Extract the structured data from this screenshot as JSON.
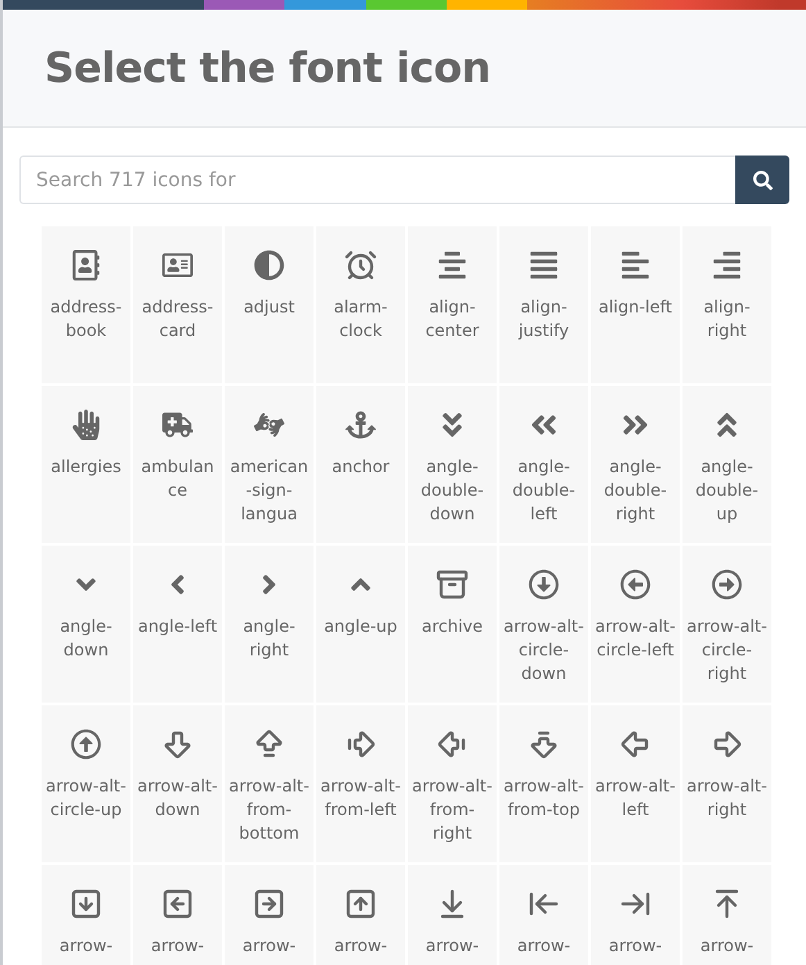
{
  "dialog": {
    "title": "Select the font icon"
  },
  "search": {
    "placeholder": "Search 717 icons for"
  },
  "icons": [
    {
      "label": "address-book"
    },
    {
      "label": "address-card"
    },
    {
      "label": "adjust"
    },
    {
      "label": "alarm-clock"
    },
    {
      "label": "align-center"
    },
    {
      "label": "align-justify"
    },
    {
      "label": "align-left"
    },
    {
      "label": "align-right"
    },
    {
      "label": "allergies"
    },
    {
      "label": "ambulance"
    },
    {
      "label": "american-sign-langua"
    },
    {
      "label": "anchor"
    },
    {
      "label": "angle-double-down"
    },
    {
      "label": "angle-double-left"
    },
    {
      "label": "angle-double-right"
    },
    {
      "label": "angle-double-up"
    },
    {
      "label": "angle-down"
    },
    {
      "label": "angle-left"
    },
    {
      "label": "angle-right"
    },
    {
      "label": "angle-up"
    },
    {
      "label": "archive"
    },
    {
      "label": "arrow-alt-circle-down"
    },
    {
      "label": "arrow-alt-circle-left"
    },
    {
      "label": "arrow-alt-circle-right"
    },
    {
      "label": "arrow-alt-circle-up"
    },
    {
      "label": "arrow-alt-down"
    },
    {
      "label": "arrow-alt-from-bottom"
    },
    {
      "label": "arrow-alt-from-left"
    },
    {
      "label": "arrow-alt-from-right"
    },
    {
      "label": "arrow-alt-from-top"
    },
    {
      "label": "arrow-alt-left"
    },
    {
      "label": "arrow-alt-right"
    },
    {
      "label": "arrow-"
    },
    {
      "label": "arrow-"
    },
    {
      "label": "arrow-"
    },
    {
      "label": "arrow-"
    },
    {
      "label": "arrow-"
    },
    {
      "label": "arrow-"
    },
    {
      "label": "arrow-"
    },
    {
      "label": "arrow-"
    }
  ]
}
